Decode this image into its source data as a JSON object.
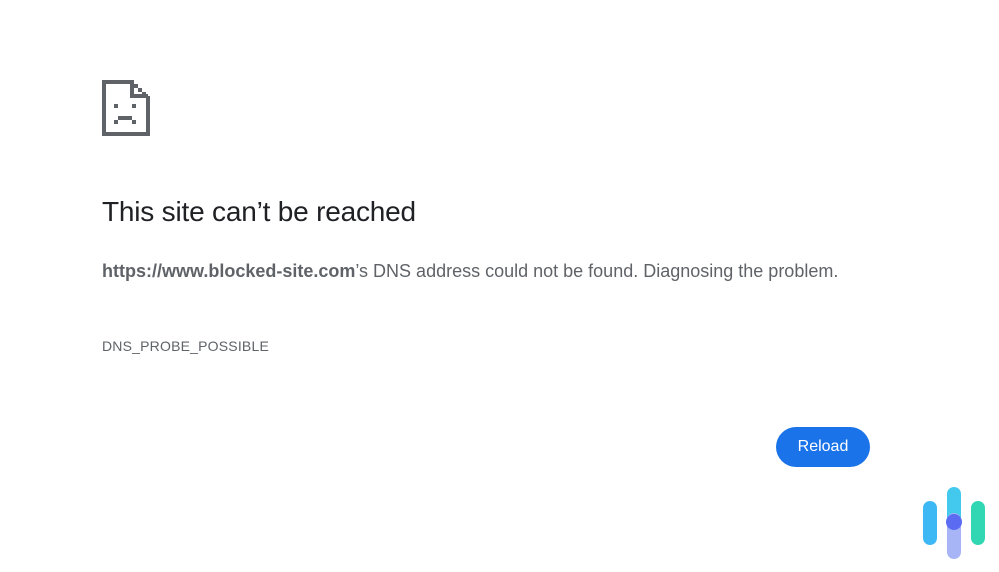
{
  "error_page": {
    "icon": "sad-document-icon",
    "title": "This site can’t be reached",
    "host": "https://www.blocked-site.com",
    "message_suffix": "’s DNS address could not be found. Diagnosing the problem.",
    "error_code": "DNS_PROBE_POSSIBLE",
    "reload_label": "Reload"
  },
  "colors": {
    "title": "#202124",
    "body_text": "#5f6368",
    "button_bg": "#1a73e8",
    "button_text": "#ffffff",
    "icon": "#5f6368"
  },
  "watermark": {
    "icon": "brand-bars-logo-icon",
    "colors": [
      "#3eb8f5",
      "#6f7bf7",
      "#31d6b3",
      "#a7b4f6"
    ]
  }
}
